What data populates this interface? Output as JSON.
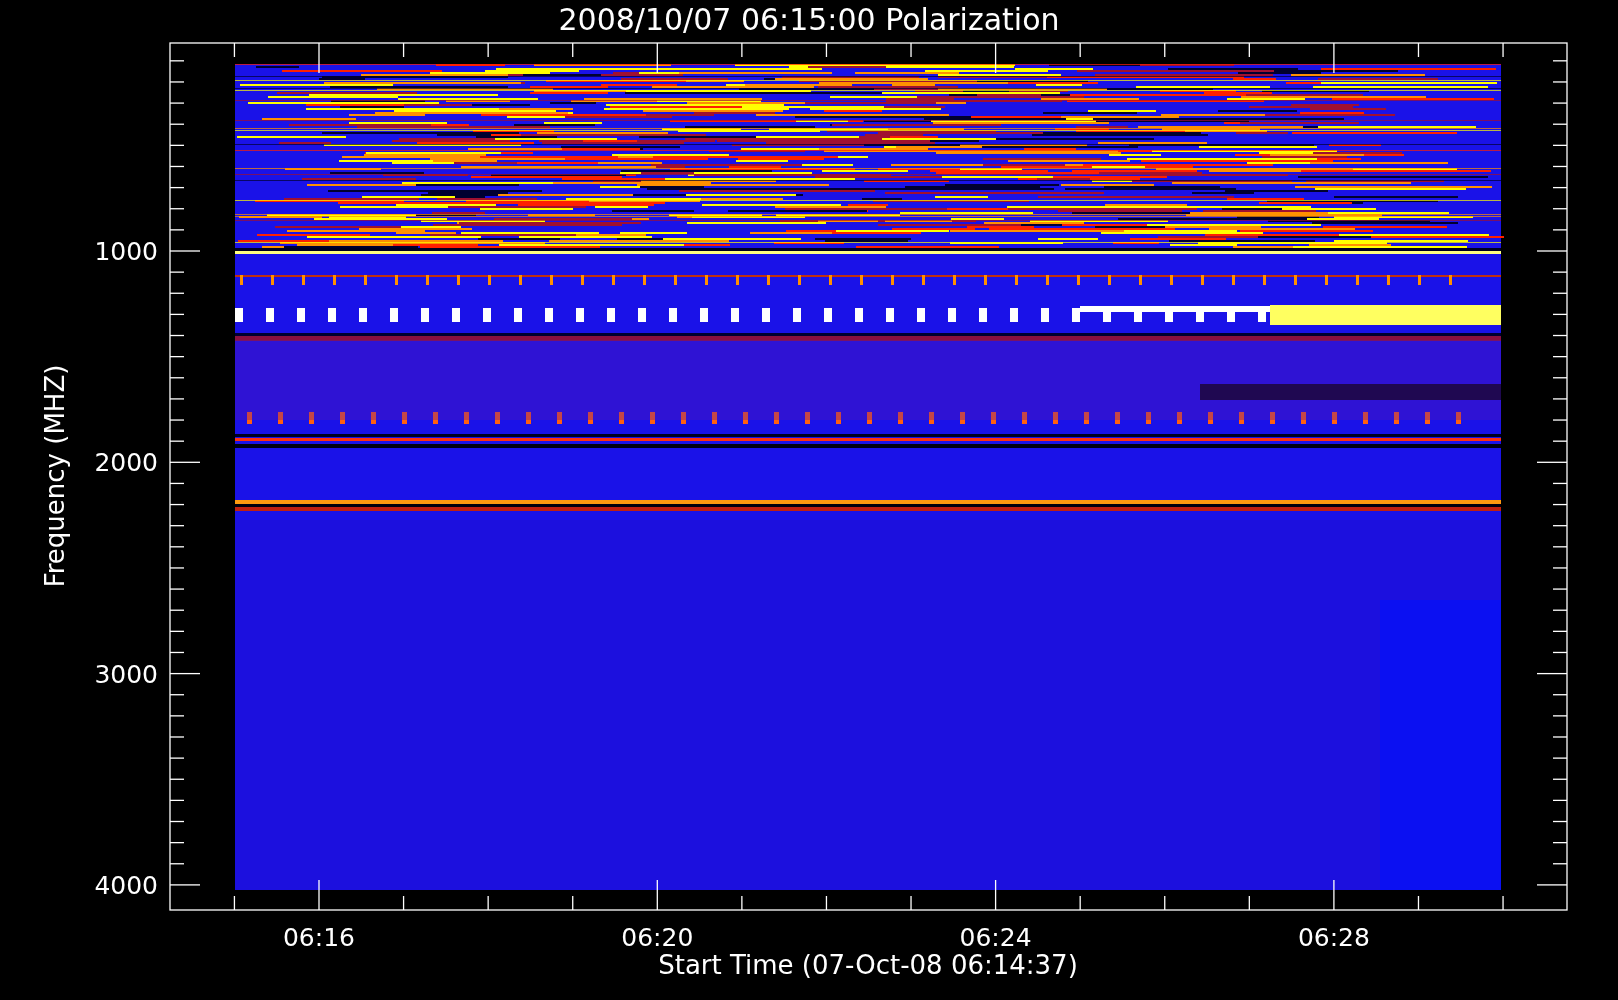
{
  "title": "2008/10/07 06:15:00 Polarization",
  "y_axis": {
    "label": "Frequency (MHZ)",
    "ticks": [
      "1000",
      "2000",
      "3000",
      "4000"
    ]
  },
  "x_axis": {
    "label": "Start Time (07-Oct-08 06:14:37)",
    "ticks": [
      "06:16",
      "06:20",
      "06:24",
      "06:28"
    ]
  }
}
